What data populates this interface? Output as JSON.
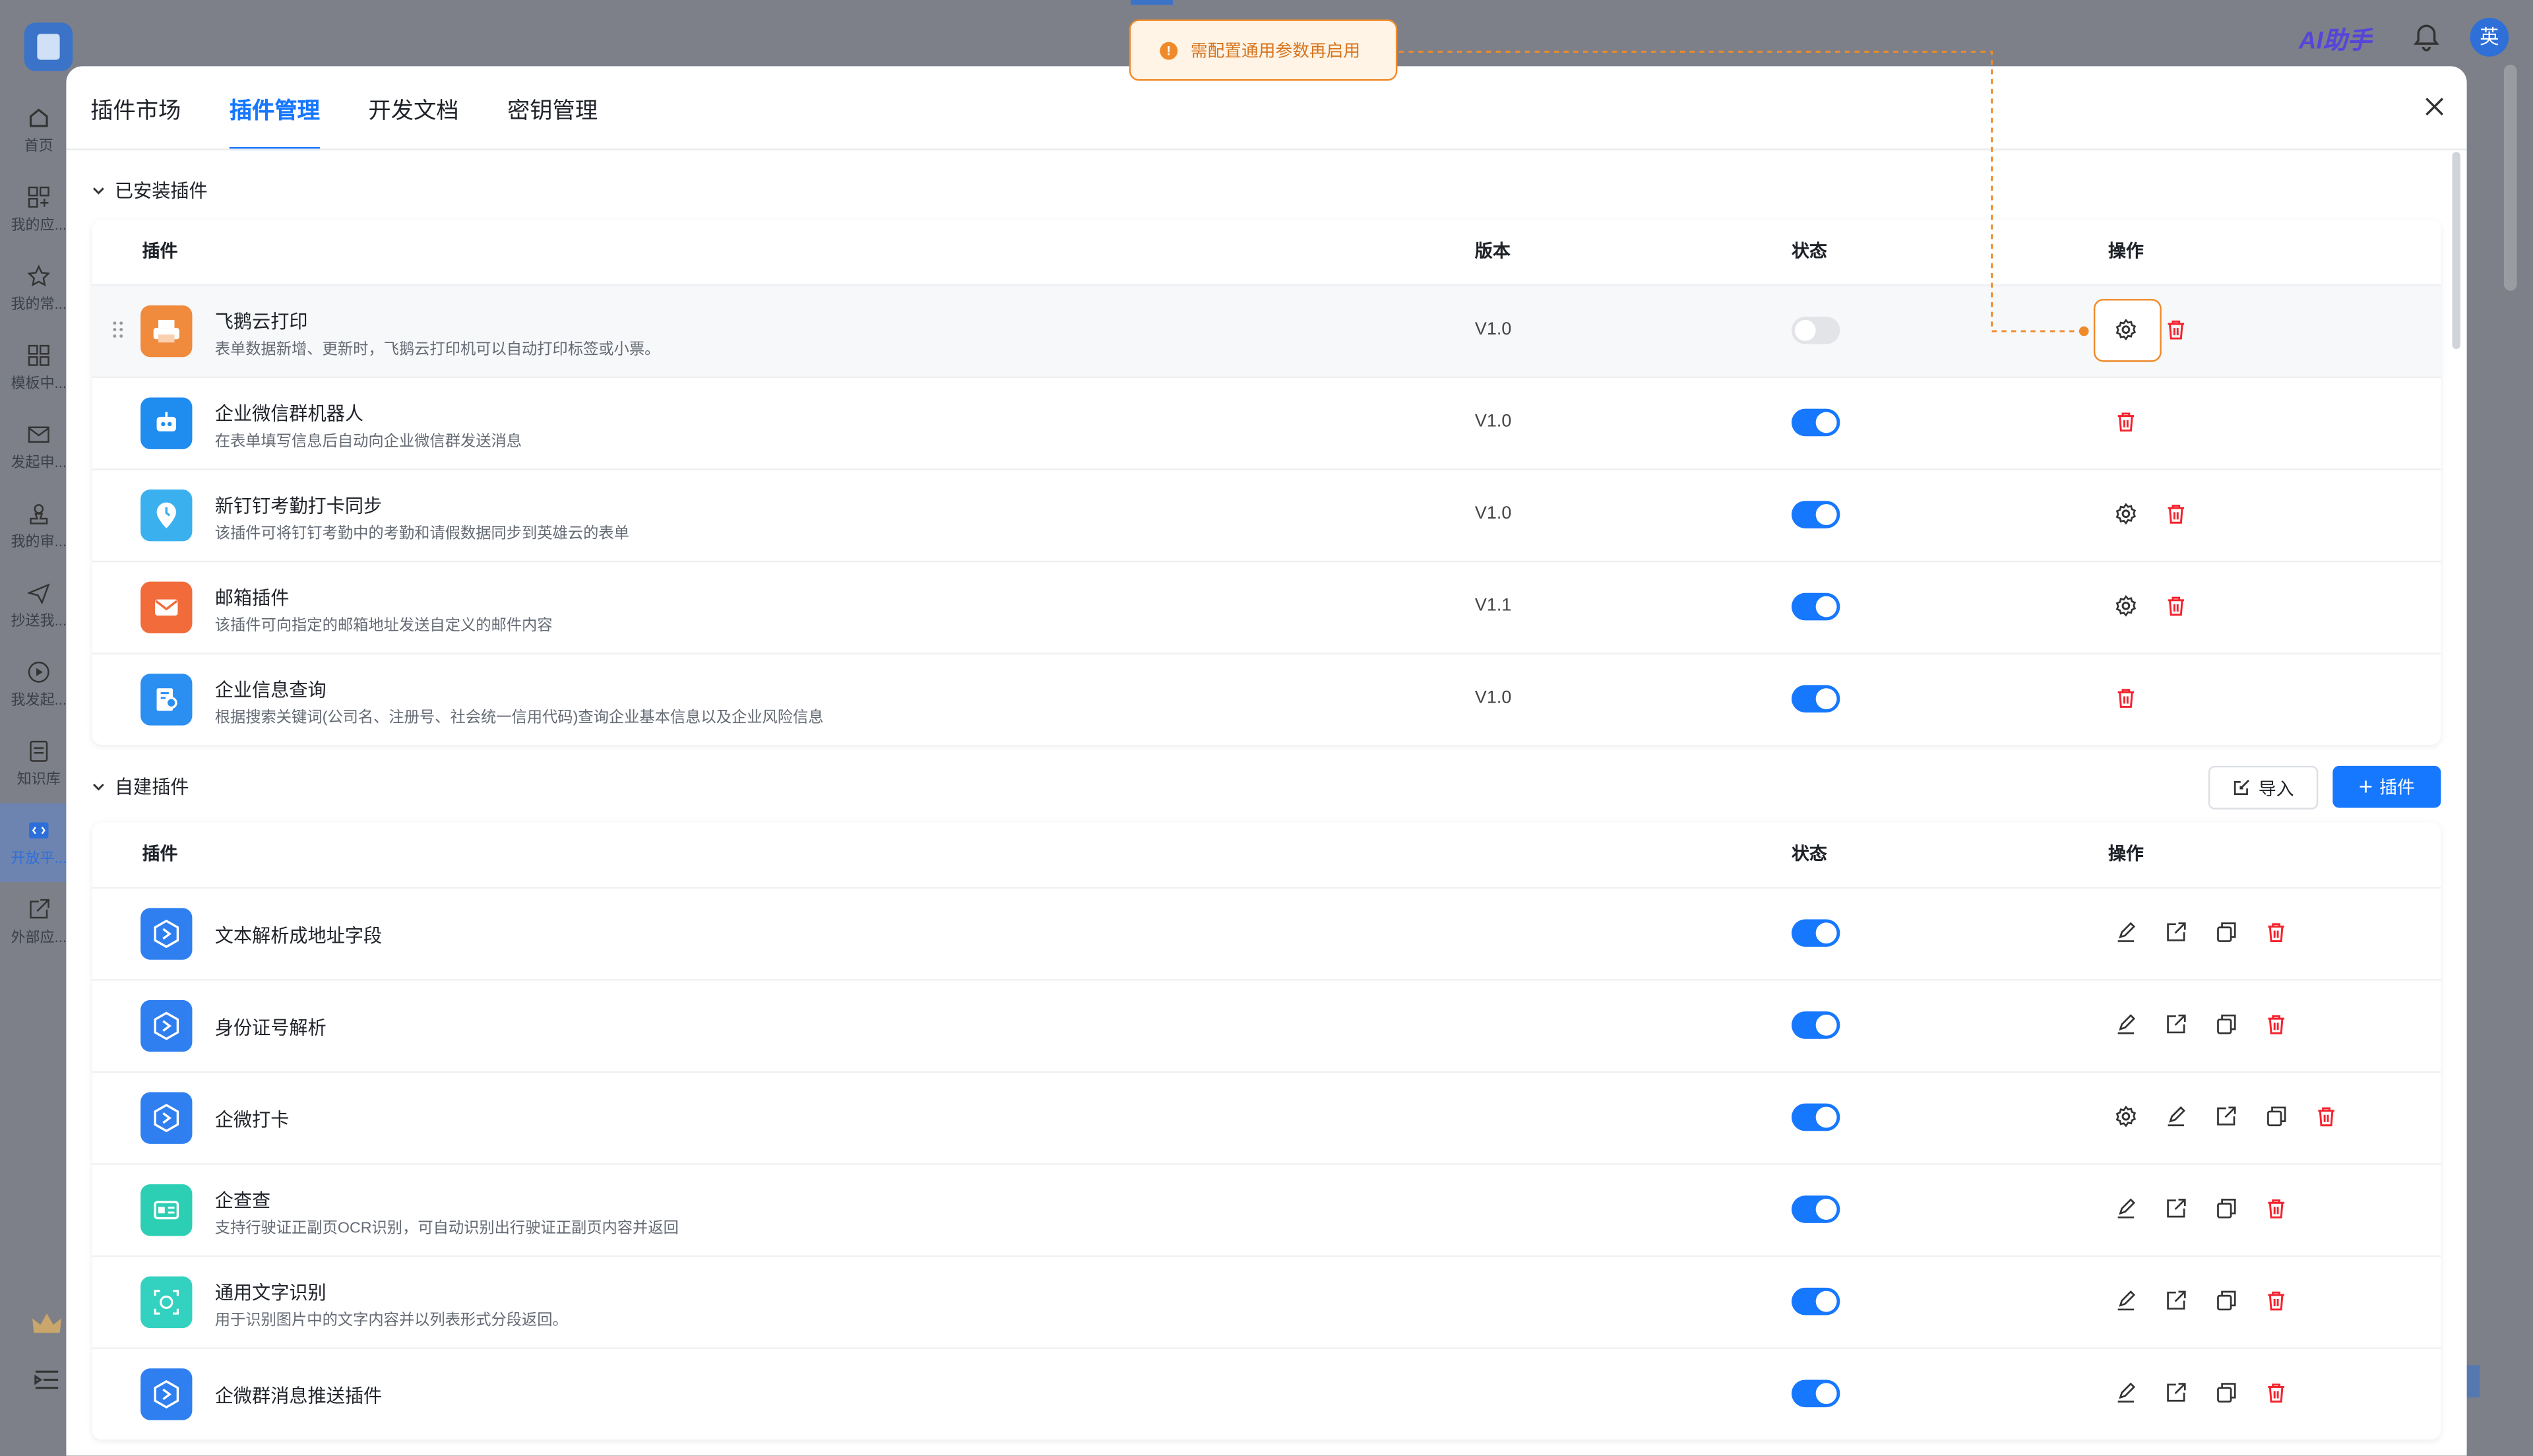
{
  "app": {
    "ai_helper": "AI助手",
    "lang_avatar": "英",
    "nav": [
      {
        "label": "首页",
        "icon": "home-icon"
      },
      {
        "label": "我的应...",
        "icon": "apps-icon"
      },
      {
        "label": "我的常...",
        "icon": "star-icon"
      },
      {
        "label": "模板中...",
        "icon": "template-icon"
      },
      {
        "label": "发起申...",
        "icon": "mail-icon"
      },
      {
        "label": "我的审...",
        "icon": "approve-icon"
      },
      {
        "label": "抄送我...",
        "icon": "send-icon"
      },
      {
        "label": "我发起...",
        "icon": "play-icon"
      },
      {
        "label": "知识库",
        "icon": "book-icon"
      },
      {
        "label": "开放平...",
        "icon": "code-icon"
      },
      {
        "label": "外部应...",
        "icon": "external-icon"
      }
    ]
  },
  "toast": {
    "message": "需配置通用参数再启用"
  },
  "modal": {
    "tabs": [
      "插件市场",
      "插件管理",
      "开发文档",
      "密钥管理"
    ],
    "active_tab": "插件管理"
  },
  "installed": {
    "title": "已安装插件",
    "columns": {
      "plugin": "插件",
      "version": "版本",
      "status": "状态",
      "actions": "操作"
    },
    "rows": [
      {
        "name": "飞鹅云打印",
        "desc": "表单数据新增、更新时，飞鹅云打印机可以自动打印标签或小票。",
        "version": "V1.0",
        "enabled": false,
        "icon_color": "#f08a3c",
        "icon": "printer-icon"
      },
      {
        "name": "企业微信群机器人",
        "desc": "在表单填写信息后自动向企业微信群发送消息",
        "version": "V1.0",
        "enabled": true,
        "icon_color": "#1f8cf0",
        "icon": "robot-icon"
      },
      {
        "name": "新钉钉考勤打卡同步",
        "desc": "该插件可将钉钉考勤中的考勤和请假数据同步到英雄云的表单",
        "version": "V1.0",
        "enabled": true,
        "icon_color": "#3bb0ee",
        "icon": "clock-pin-icon"
      },
      {
        "name": "邮箱插件",
        "desc": "该插件可向指定的邮箱地址发送自定义的邮件内容",
        "version": "V1.1",
        "enabled": true,
        "icon_color": "#f26b3a",
        "icon": "envelope-icon"
      },
      {
        "name": "企业信息查询",
        "desc": "根据搜索关键词(公司名、注册号、社会统一信用代码)查询企业基本信息以及企业风险信息",
        "version": "V1.0",
        "enabled": true,
        "icon_color": "#2b8ff2",
        "icon": "company-search-icon"
      }
    ]
  },
  "custom": {
    "title": "自建插件",
    "import_label": "导入",
    "add_label": "插件",
    "columns": {
      "plugin": "插件",
      "status": "状态",
      "actions": "操作"
    },
    "rows": [
      {
        "name": "文本解析成地址字段",
        "desc": "",
        "enabled": true,
        "icon_color": "#2f7ff0",
        "icon": "plugin-hex-icon",
        "has_settings": false
      },
      {
        "name": "身份证号解析",
        "desc": "",
        "enabled": true,
        "icon_color": "#2f7ff0",
        "icon": "plugin-hex-icon",
        "has_settings": false
      },
      {
        "name": "企微打卡",
        "desc": "",
        "enabled": true,
        "icon_color": "#2f7ff0",
        "icon": "plugin-hex-icon",
        "has_settings": true
      },
      {
        "name": "企查查",
        "desc": "支持行驶证正副页OCR识别，可自动识别出行驶证正副页内容并返回",
        "enabled": true,
        "icon_color": "#2ccfb4",
        "icon": "id-card-icon",
        "has_settings": false
      },
      {
        "name": "通用文字识别",
        "desc": "用于识别图片中的文字内容并以列表形式分段返回。",
        "enabled": true,
        "icon_color": "#33d1c0",
        "icon": "ocr-icon",
        "has_settings": false
      },
      {
        "name": "企微群消息推送插件",
        "desc": "",
        "enabled": true,
        "icon_color": "#2f7ff0",
        "icon": "plugin-hex-icon",
        "has_settings": false
      }
    ]
  },
  "colors": {
    "accent": "#1677ff",
    "danger": "#f5222d",
    "warning": "#ef8a2a"
  }
}
